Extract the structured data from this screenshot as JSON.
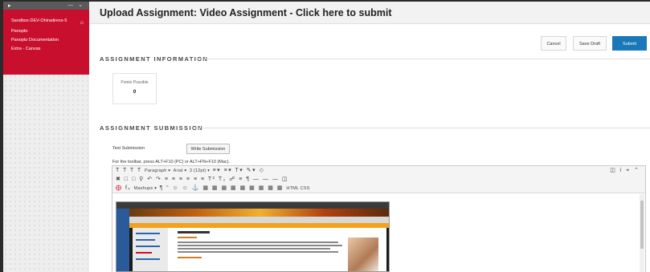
{
  "sidebar": {
    "course_name": "Sandbox-DEV-Ohiradirexs-5",
    "items": [
      {
        "label": "Panopto"
      },
      {
        "label": "Panopto Documentation"
      },
      {
        "label": "Extra - Canvas"
      }
    ]
  },
  "header": {
    "title": "Upload Assignment: Video Assignment - Click here to submit"
  },
  "actions": {
    "cancel": "Cancel",
    "save_draft": "Save Draft",
    "submit": "Submit"
  },
  "assignment_information": {
    "heading": "ASSIGNMENT INFORMATION",
    "points_label": "Points Possible",
    "points_value": "0"
  },
  "assignment_submission": {
    "heading": "ASSIGNMENT SUBMISSION",
    "text_submission_label": "Text Submission",
    "write_submission_button": "Write Submission",
    "toolbar_hint": "For the toolbar, press ALT+F10 (PC) or ALT+FN+F10 (Mac)."
  },
  "editor": {
    "paragraph_select": "Paragraph",
    "font_select": "Arial",
    "size_select": "3 (12pt)",
    "mashups_menu": "Mashups",
    "html_button": "HTML CSS"
  },
  "colors": {
    "brand_red": "#c8102e",
    "submit_blue": "#1a78b8"
  }
}
